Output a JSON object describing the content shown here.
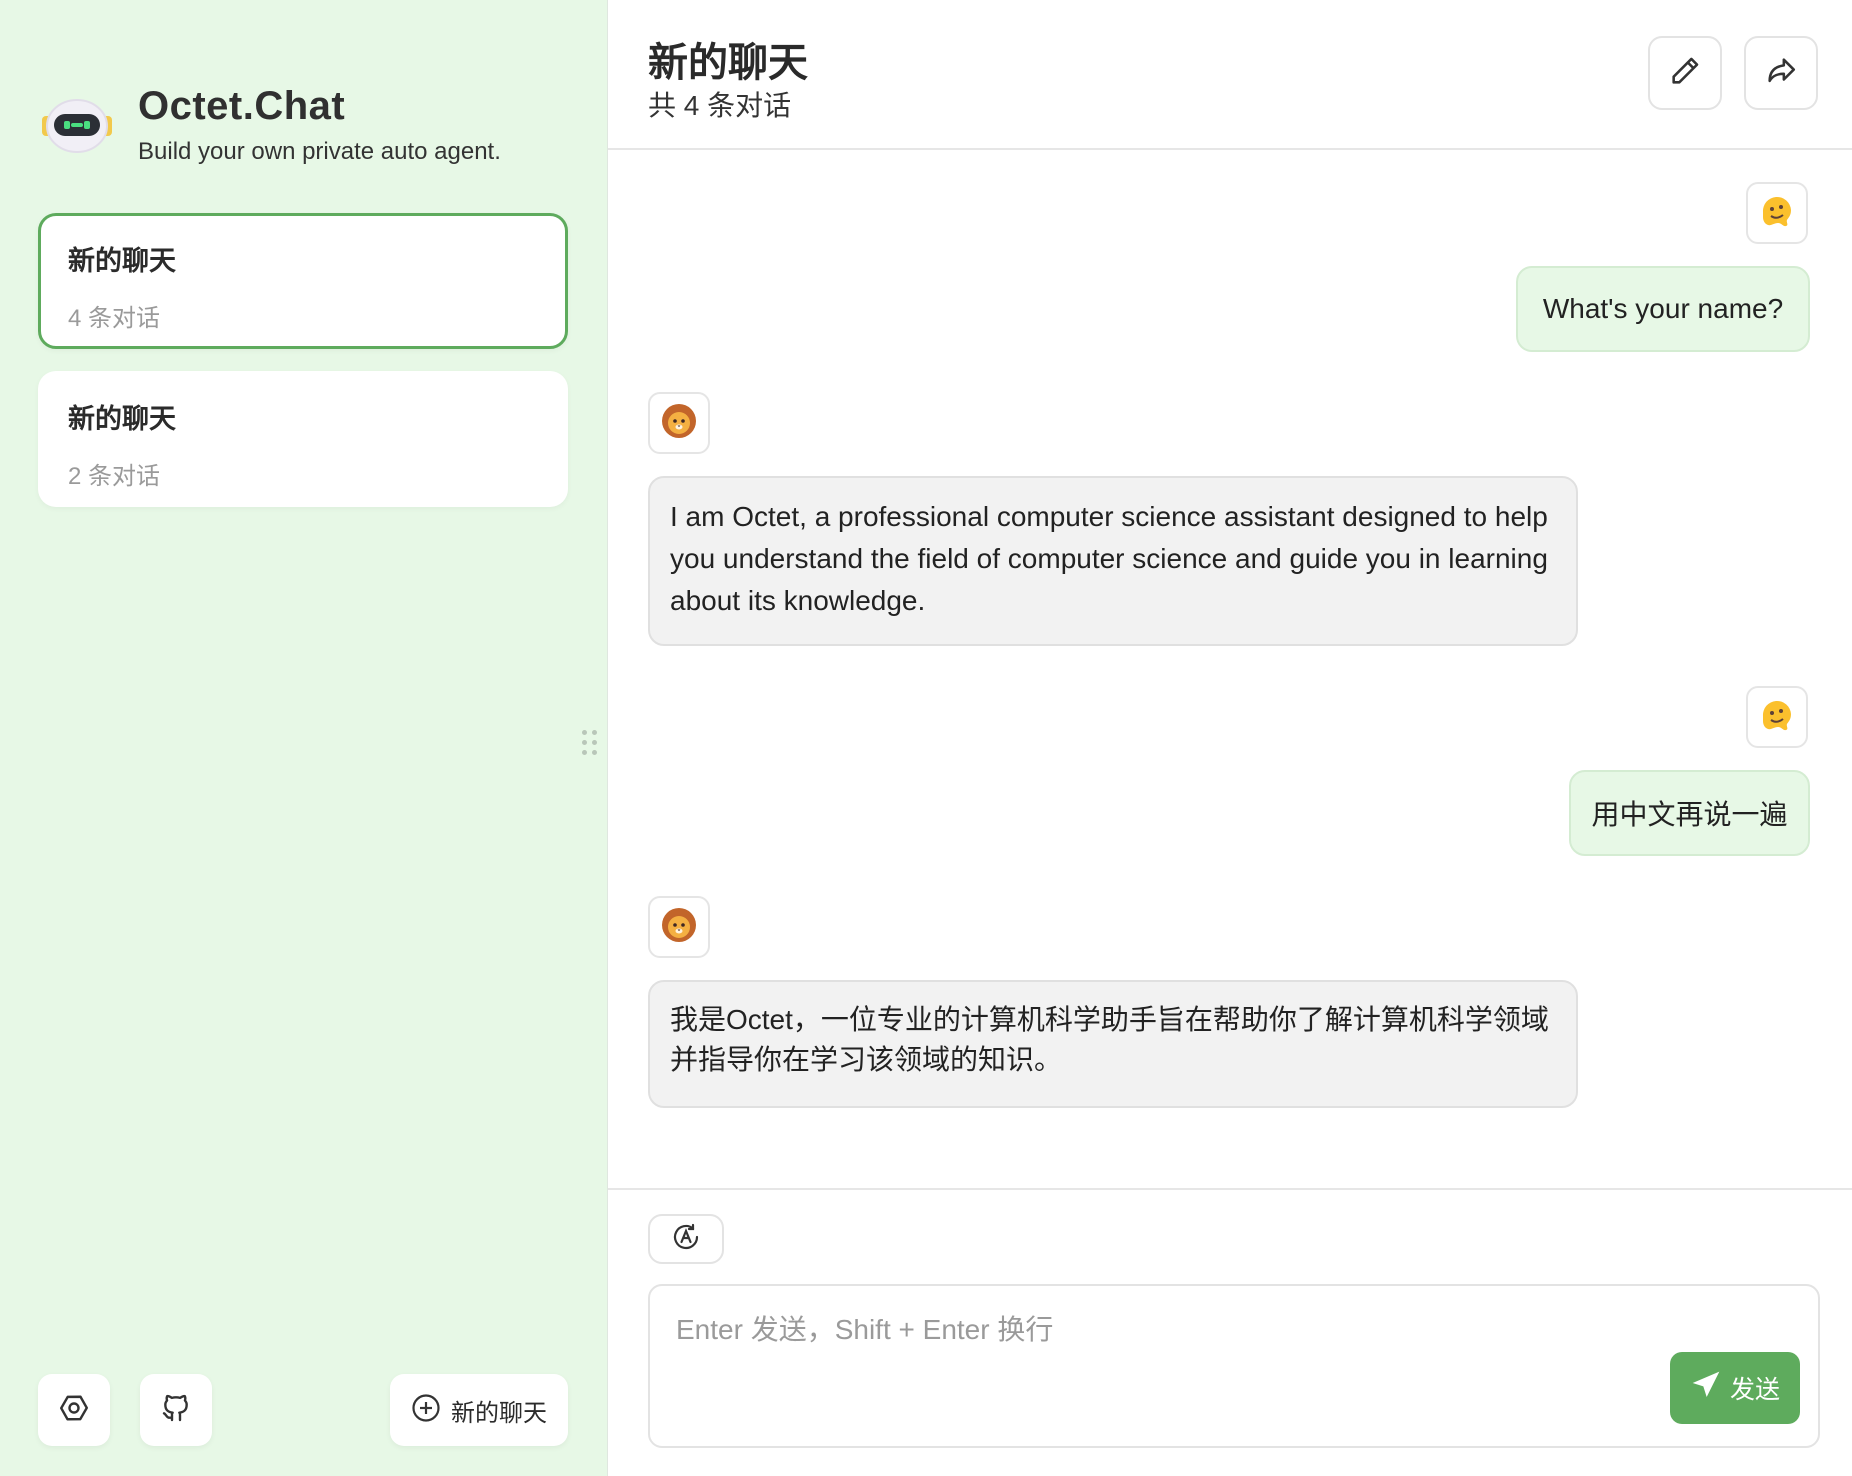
{
  "brand": {
    "title": "Octet.Chat",
    "subtitle": "Build your own private auto agent.",
    "logo_icon": "robot-logo-icon"
  },
  "sidebar": {
    "chats": [
      {
        "title": "新的聊天",
        "count": "4 条对话",
        "active": true
      },
      {
        "title": "新的聊天",
        "count": "2 条对话",
        "active": false
      }
    ],
    "bottom": {
      "settings_icon": "settings-icon",
      "github_icon": "github-icon",
      "new_chat_label": "新的聊天"
    }
  },
  "header": {
    "title": "新的聊天",
    "subtitle": "共 4 条对话",
    "actions": [
      "edit-icon",
      "share-icon"
    ]
  },
  "messages": [
    {
      "role": "user",
      "avatar": "melting-face-emoji",
      "text": "What's your name?"
    },
    {
      "role": "assistant",
      "avatar": "lion-emoji",
      "text": "I am Octet, a professional computer science assistant designed to help you understand the field of computer science and guide you in learning about its knowledge."
    },
    {
      "role": "user",
      "avatar": "melting-face-emoji",
      "text": "用中文再说一遍"
    },
    {
      "role": "assistant",
      "avatar": "lion-emoji",
      "text": "我是Octet，一位专业的计算机科学助手旨在帮助你了解计算机科学领域并指导你在学习该领域的知识。"
    }
  ],
  "composer": {
    "placeholder": "Enter 发送，Shift + Enter 换行",
    "value": "",
    "send_label": "发送",
    "tool_icon": "auto-mode-icon"
  },
  "colors": {
    "accent": "#5eab5d",
    "sidebar_bg": "#e7f8e6",
    "user_bubble": "#e7f8e6",
    "bot_bubble": "#f2f2f2"
  }
}
